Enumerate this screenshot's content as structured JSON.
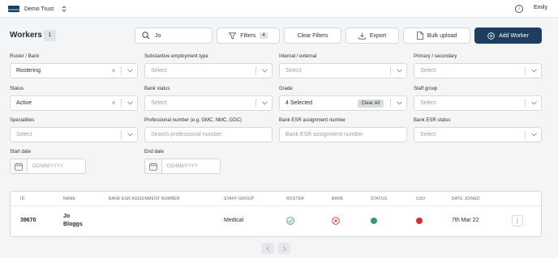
{
  "header": {
    "org_name": "Demo Trust",
    "user_name": "Emily"
  },
  "page": {
    "title": "Workers",
    "count": "1"
  },
  "toolbar": {
    "search_value": "Jo",
    "filters_label": "Filters",
    "filters_count": "4",
    "clear_filters_label": "Clear Filters",
    "export_label": "Export",
    "bulk_upload_label": "Bulk upload",
    "add_worker_label": "Add Worker"
  },
  "filters": {
    "roster_bank": {
      "label": "Roster / Bank",
      "value": "Rostering"
    },
    "substantive": {
      "label": "Substantive employment type",
      "placeholder": "Select"
    },
    "internal_external": {
      "label": "Internal / external",
      "placeholder": "Select"
    },
    "primary_secondary": {
      "label": "Primary / secondary",
      "placeholder": "Select"
    },
    "status": {
      "label": "Status",
      "value": "Active"
    },
    "bank_status": {
      "label": "Bank status",
      "placeholder": "Select"
    },
    "grade": {
      "label": "Grade",
      "value": "4 Selected",
      "clear_all": "Clear All"
    },
    "staff_group": {
      "label": "Staff group",
      "placeholder": "Select"
    },
    "specialities": {
      "label": "Specialities",
      "placeholder": "Select"
    },
    "professional_number": {
      "label": "Professional number (e.g. GMC, NMC, GDC)",
      "placeholder": "Search professional number"
    },
    "bank_esr_number": {
      "label": "Bank ESR assignment number",
      "placeholder": "Bank ESR assignment number"
    },
    "bank_esr_status": {
      "label": "Bank ESR status",
      "placeholder": "Select"
    },
    "start_date": {
      "label": "Start date",
      "placeholder": "DD/MM/YYYY"
    },
    "end_date": {
      "label": "End date",
      "placeholder": "DD/MM/YYYY"
    }
  },
  "table": {
    "columns": [
      "ID",
      "NAME",
      "BANK ESR ASSIGNMENT NUMBER",
      "STAFF GROUP",
      "ROSTER",
      "BANK",
      "STATUS",
      "SSO",
      "DATE JOINED"
    ],
    "rows": [
      {
        "id": "39670",
        "name_first": "Jo",
        "name_last": "Bloggs",
        "bank_esr": "",
        "staff_group": "Medical",
        "roster": "check",
        "bank": "cross",
        "status_color": "#3a9a6b",
        "sso_color": "#d32f2f",
        "date_joined": "7th Mar 22"
      }
    ]
  },
  "icons": {
    "search": "search-icon",
    "filter": "filter-icon",
    "export": "download-icon",
    "bulk_upload": "file-icon",
    "add": "plus-circle-icon",
    "info": "info-icon",
    "calendar": "calendar-icon",
    "chevron": "chevron-down-icon"
  },
  "colors": {
    "primary": "#1c3f60",
    "success": "#3a9a6b",
    "danger": "#d32f2f"
  }
}
